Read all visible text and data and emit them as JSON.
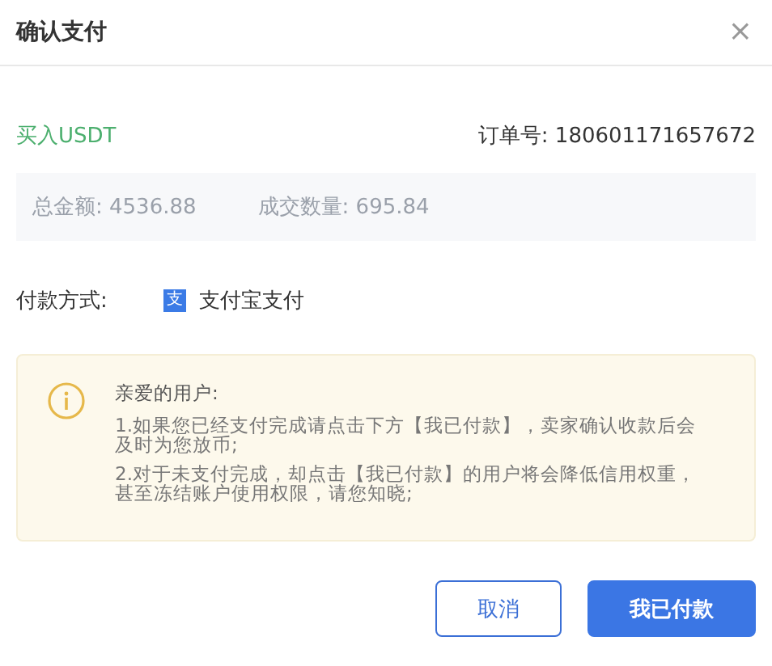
{
  "dialog": {
    "title": "确认支付",
    "close": "×"
  },
  "order": {
    "side": "买入USDT",
    "number": "订单号: 180601171657672"
  },
  "summary": [
    "总金额: 4536.88",
    "成交数量: 695.84"
  ],
  "payment": {
    "label": "付款方式:",
    "icon_glyph": "支",
    "method": "支付宝支付"
  },
  "notice": {
    "heading": "亲爱的用户:",
    "items": [
      "1.如果您已经支付完成请点击下方【我已付款】，卖家确认收款后会及时为您放币;",
      "2.对于未支付完成，却点击【我已付款】的用户将会降低信用权重，甚至冻结账户使用权限，请您知晓;"
    ]
  },
  "buttons": [
    {
      "label": "取消",
      "kind": "secondary"
    },
    {
      "label": "我已付款",
      "kind": "primary"
    }
  ]
}
